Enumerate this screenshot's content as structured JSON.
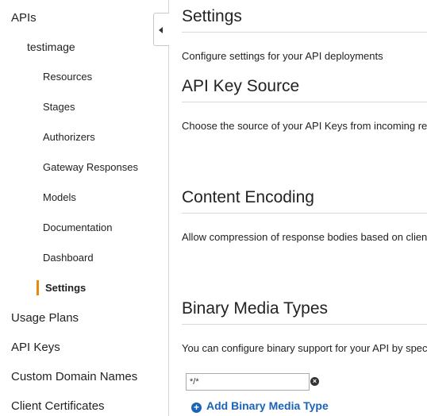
{
  "sidebar": {
    "apis_label": "APIs",
    "api_name": "testimage",
    "items": [
      {
        "label": "Resources"
      },
      {
        "label": "Stages"
      },
      {
        "label": "Authorizers"
      },
      {
        "label": "Gateway Responses"
      },
      {
        "label": "Models"
      },
      {
        "label": "Documentation"
      },
      {
        "label": "Dashboard"
      },
      {
        "label": "Settings",
        "active": true
      }
    ],
    "bottom": [
      {
        "label": "Usage Plans"
      },
      {
        "label": "API Keys"
      },
      {
        "label": "Custom Domain Names"
      },
      {
        "label": "Client Certificates"
      }
    ],
    "active_color": "#e8890c"
  },
  "main": {
    "title": "Settings",
    "subtitle": "Configure settings for your API deployments",
    "api_key_source": {
      "heading": "API Key Source",
      "description": "Choose the source of your API Keys from incoming requests"
    },
    "content_encoding": {
      "heading": "Content Encoding",
      "description": "Allow compression of response bodies based on client's Accept-Encoding header"
    },
    "binary_media": {
      "heading": "Binary Media Types",
      "description": "You can configure binary support for your API by specifying which media types should be treated as binary types",
      "input_value": "*/*",
      "add_label": "Add Binary Media Type"
    },
    "link_color": "#1a63b8"
  }
}
